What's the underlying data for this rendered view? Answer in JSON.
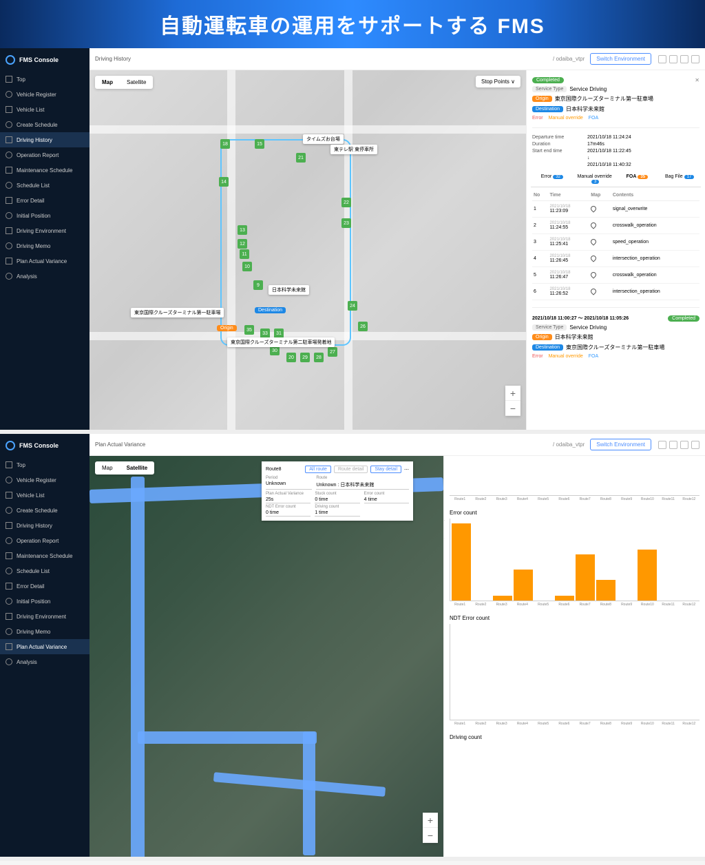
{
  "hero": "自動運転車の運用をサポートする FMS",
  "brand": "FMS Console",
  "sidebar": [
    "Top",
    "Vehicle Register",
    "Vehicle List",
    "Create Schedule",
    "Driving History",
    "Operation Report",
    "Maintenance Schedule",
    "Schedule List",
    "Error Detail",
    "Initial Position",
    "Driving Environment",
    "Driving Memo",
    "Plan Actual Variance",
    "Analysis"
  ],
  "panel1": {
    "page_title": "Driving History",
    "breadcrumb": "/ odaiba_vtpr",
    "switch": "Switch Environment",
    "map_tabs": [
      "Map",
      "Satellite"
    ],
    "stop_dd": "Stop Points  ∨",
    "callouts": {
      "c1": "タイムズお台場",
      "c2": "東テレ駅 東停車所",
      "c3": "日本科学未来館",
      "c4": "東京国際クルーズターミナル第一駐車場",
      "c5": "東京国際クルーズターミナル第二駐車場発着地",
      "origin": "Origin",
      "destination": "Destination"
    },
    "detail": {
      "completed": "Completed",
      "service_type_k": "Service Type",
      "service_type_v": "Service Driving",
      "origin_label": "Origin",
      "origin_v": "東京国際クルーズターミナル第一駐車場",
      "dest_label": "Destination",
      "dest_v": "日本科学未来館",
      "links": {
        "error": "Error",
        "mo": "Manual override",
        "foa": "FOA"
      },
      "departure_k": "Departure time",
      "departure_v": "2021/10/18 11:24:24",
      "duration_k": "Duration",
      "duration_v": "17m46s",
      "end_k": "Start end time",
      "end_v1": "2021/10/18 11:22:45",
      "end_v2": "2021/10/18 11:40:32",
      "tabs": [
        {
          "l": "Error",
          "c": "32"
        },
        {
          "l": "Manual override",
          "c": "3"
        },
        {
          "l": "FOA",
          "c": "35"
        },
        {
          "l": "Bag File",
          "c": "17"
        }
      ],
      "table_head": [
        "No",
        "Time",
        "Map",
        "Contents"
      ],
      "rows": [
        {
          "no": "1",
          "d": "2021/10/18",
          "t": "11:23:09",
          "c": "signal_overwrite"
        },
        {
          "no": "2",
          "d": "2021/10/18",
          "t": "11:24:55",
          "c": "crosswalk_operation"
        },
        {
          "no": "3",
          "d": "2021/10/18",
          "t": "11:25:41",
          "c": "speed_operation"
        },
        {
          "no": "4",
          "d": "2021/10/18",
          "t": "11:26:45",
          "c": "intersection_operation"
        },
        {
          "no": "5",
          "d": "2021/10/18",
          "t": "11:26:47",
          "c": "crosswalk_operation"
        },
        {
          "no": "6",
          "d": "2021/10/18",
          "t": "11:26:52",
          "c": "intersection_operation"
        }
      ],
      "prev_range": "2021/10/18 11:00:27 ～ 2021/10/18 11:05:26",
      "prev_origin": "日本科学未来館",
      "prev_dest": "東京国際クルーズターミナル第一駐車場"
    }
  },
  "panel2": {
    "page_title": "Plan Actual Variance",
    "breadcrumb": "/ odaiba_vtpr",
    "route_box": {
      "title": "Route8",
      "btns": [
        "All route",
        "Route detail",
        "Stay detail"
      ],
      "period_k": "Period",
      "period_v": "Unknown",
      "route_k": "Route",
      "route_v": "Unknown : 日本科学未来館",
      "pav_k": "Plan Actual Variance",
      "pav_v": "25s",
      "stuck_k": "Stuck count",
      "stuck_v": "0 time",
      "err_k": "Error count",
      "err_v": "4 time",
      "ndt_k": "NDT Error count",
      "ndt_v": "0 time",
      "drv_k": "Driving count",
      "drv_v": "1 time"
    },
    "charts": {
      "error_title": "Error count",
      "ndt_title": "NDT Error count",
      "driving_title": "Driving count",
      "routes": [
        "Route1",
        "Route2",
        "Route3",
        "Route4",
        "Route5",
        "Route6",
        "Route7",
        "Route8",
        "Route9",
        "Route10",
        "Route11",
        "Route12"
      ]
    }
  },
  "chart_data": [
    {
      "type": "bar",
      "title": "Error count",
      "categories": [
        "Route1",
        "Route2",
        "Route3",
        "Route4",
        "Route5",
        "Route6",
        "Route7",
        "Route8",
        "Route9",
        "Route10",
        "Route11",
        "Route12"
      ],
      "values": [
        15,
        0,
        1,
        6,
        0,
        1,
        9,
        4,
        0,
        10,
        0,
        0
      ],
      "ylim": [
        0,
        16
      ],
      "yticks": [
        0,
        4,
        8,
        12,
        16
      ]
    },
    {
      "type": "bar",
      "title": "NDT Error count",
      "categories": [
        "Route1",
        "Route2",
        "Route3",
        "Route4",
        "Route5",
        "Route6",
        "Route7",
        "Route8",
        "Route9",
        "Route10",
        "Route11",
        "Route12"
      ],
      "values": [
        0,
        0,
        0,
        0,
        0,
        0,
        0,
        0,
        0,
        0,
        0,
        0
      ],
      "ylim": [
        0,
        1
      ],
      "yticks": [
        0,
        1
      ]
    }
  ]
}
